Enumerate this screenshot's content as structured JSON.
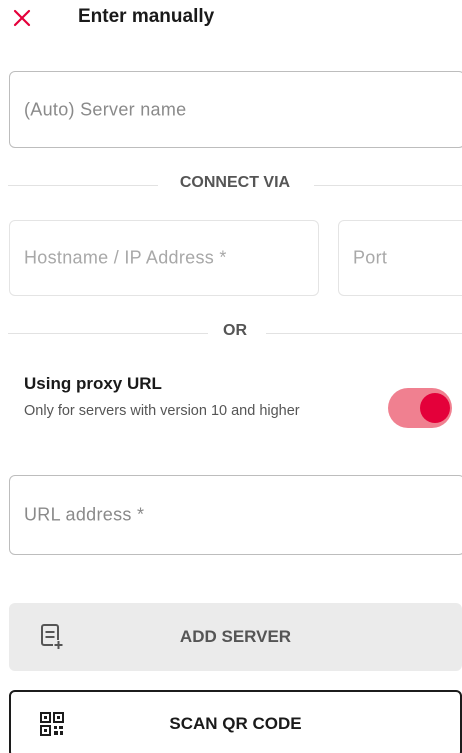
{
  "header": {
    "title": "Enter manually",
    "close_icon": "close-icon",
    "close_color": "#e4003a"
  },
  "server_name": {
    "placeholder": "(Auto) Server name"
  },
  "connect_via": {
    "label": "CONNECT VIA"
  },
  "hostname": {
    "placeholder": "Hostname / IP Address *"
  },
  "port": {
    "placeholder": "Port"
  },
  "or_divider": {
    "label": "OR"
  },
  "proxy": {
    "title": "Using proxy URL",
    "description": "Only for servers with version 10 and higher",
    "enabled": true,
    "accent_color": "#e4003a"
  },
  "url_address": {
    "placeholder": "URL address *"
  },
  "buttons": {
    "add_server": {
      "label": "ADD SERVER",
      "icon": "add-list-icon"
    },
    "scan_qr": {
      "label": "SCAN QR CODE",
      "icon": "qr-code-icon"
    }
  }
}
